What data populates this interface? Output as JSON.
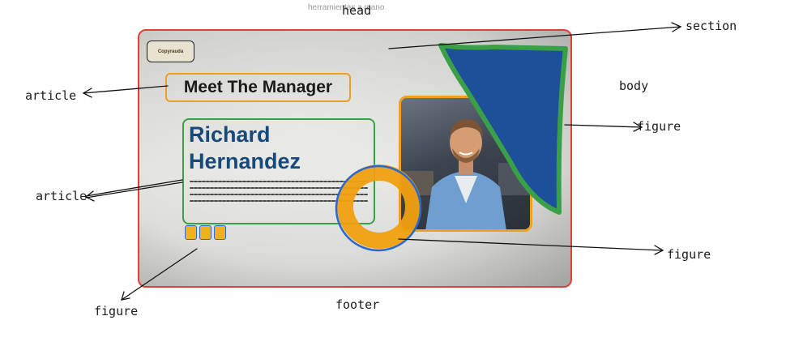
{
  "watermark": "herramientas a mano",
  "labels": {
    "head": "head",
    "section": "section",
    "body": "body",
    "article_top": "article",
    "article_bottom": "article",
    "figure_right": "figure",
    "figure_circle": "figure",
    "figure_bottom": "figure",
    "footer": "footer"
  },
  "slide": {
    "logo_text": "Copyrauda",
    "title": "Meet The Manager",
    "name_line1": "Richard",
    "name_line2": "Hernandez"
  },
  "colors": {
    "section_outline": "#e0403a",
    "article_outline": "#f0a020",
    "name_outline": "#3aa048",
    "figure_outline": "#2a6ad0",
    "blue_shape": "#1d4f9a",
    "ring": "#f0a010"
  }
}
